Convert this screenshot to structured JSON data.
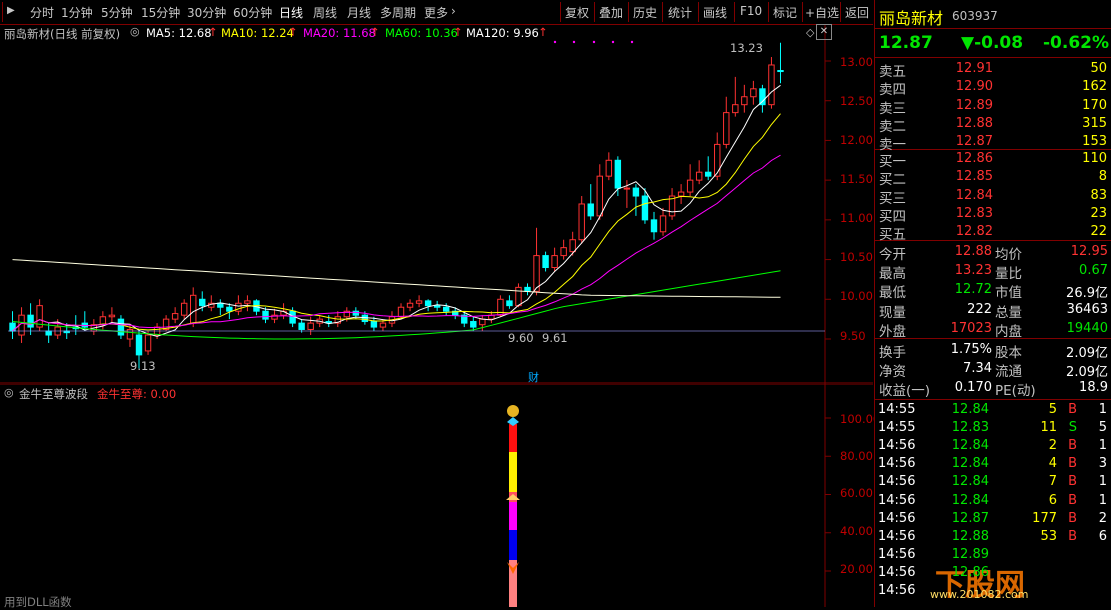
{
  "toolbar": {
    "periods": [
      "分时",
      "1分钟",
      "5分钟",
      "15分钟",
      "30分钟",
      "60分钟",
      "日线",
      "周线",
      "月线",
      "多周期",
      "更多"
    ],
    "active_period": "日线",
    "more_arrow": "›",
    "actions": [
      "复权",
      "叠加",
      "历史",
      "统计",
      "画线",
      "F10",
      "标记",
      "+自选",
      "返回"
    ]
  },
  "main_chart": {
    "header": "丽岛新材(日线 前复权)",
    "ma": [
      {
        "label": "MA5: 12.68",
        "color": "#ffffff"
      },
      {
        "label": "MA10: 12.24",
        "color": "#ffff00"
      },
      {
        "label": "MA20: 11.68",
        "color": "#ff00ff"
      },
      {
        "label": "MA60: 10.36",
        "color": "#00ff00"
      },
      {
        "label": "MA120: 9.96",
        "color": "#ffffff"
      }
    ],
    "up_arrow": "↑",
    "price_ticks": [
      "13.00",
      "12.50",
      "12.00",
      "11.50",
      "11.00",
      "10.50",
      "10.00",
      "9.50"
    ],
    "annotations": {
      "high": "13.23",
      "low": "9.13",
      "mid1": "9.60",
      "mid2": "9.61",
      "cai": "财"
    }
  },
  "sub_chart": {
    "indicator_name": "金牛至尊波段",
    "value_label": "金牛至尊: 0.00",
    "ticks": [
      "100.00",
      "80.00",
      "60.00",
      "40.00",
      "20.00"
    ],
    "dll_text": "用到DLL函数"
  },
  "quote": {
    "name": "丽岛新材",
    "code": "603937",
    "price": "12.87",
    "change": "▼-0.08",
    "pct": "-0.62%",
    "sell": [
      {
        "label": "卖五",
        "price": "12.91",
        "vol": "50"
      },
      {
        "label": "卖四",
        "price": "12.90",
        "vol": "162"
      },
      {
        "label": "卖三",
        "price": "12.89",
        "vol": "170"
      },
      {
        "label": "卖二",
        "price": "12.88",
        "vol": "315"
      },
      {
        "label": "卖一",
        "price": "12.87",
        "vol": "153"
      }
    ],
    "buy": [
      {
        "label": "买一",
        "price": "12.86",
        "vol": "110"
      },
      {
        "label": "买二",
        "price": "12.85",
        "vol": "8"
      },
      {
        "label": "买三",
        "price": "12.84",
        "vol": "83"
      },
      {
        "label": "买四",
        "price": "12.83",
        "vol": "23"
      },
      {
        "label": "买五",
        "price": "12.82",
        "vol": "22"
      }
    ],
    "stats": [
      {
        "l1": "今开",
        "v1": "12.88",
        "c1": "red",
        "l2": "均价",
        "v2": "12.95",
        "c2": "red"
      },
      {
        "l1": "最高",
        "v1": "13.23",
        "c1": "red",
        "l2": "量比",
        "v2": "0.67",
        "c2": "green"
      },
      {
        "l1": "最低",
        "v1": "12.72",
        "c1": "green",
        "l2": "市值",
        "v2": "26.9亿",
        "c2": "white"
      },
      {
        "l1": "现量",
        "v1": "222",
        "c1": "white",
        "l2": "总量",
        "v2": "36463",
        "c2": "white"
      },
      {
        "l1": "外盘",
        "v1": "17023",
        "c1": "red",
        "l2": "内盘",
        "v2": "19440",
        "c2": "green"
      }
    ],
    "fin": [
      {
        "l1": "换手",
        "v1": "1.75%",
        "l2": "股本",
        "v2": "2.09亿"
      },
      {
        "l1": "净资",
        "v1": "7.34",
        "l2": "流通",
        "v2": "2.09亿"
      },
      {
        "l1": "收益(一)",
        "v1": "0.170",
        "l2": "PE(动)",
        "v2": "18.9"
      }
    ],
    "ticks": [
      {
        "t": "14:55",
        "p": "12.84",
        "v": "5",
        "bs": "B",
        "n": "1"
      },
      {
        "t": "14:55",
        "p": "12.83",
        "v": "11",
        "bs": "S",
        "n": "5"
      },
      {
        "t": "14:56",
        "p": "12.84",
        "v": "2",
        "bs": "B",
        "n": "1"
      },
      {
        "t": "14:56",
        "p": "12.84",
        "v": "4",
        "bs": "B",
        "n": "3"
      },
      {
        "t": "14:56",
        "p": "12.84",
        "v": "7",
        "bs": "B",
        "n": "1"
      },
      {
        "t": "14:56",
        "p": "12.84",
        "v": "6",
        "bs": "B",
        "n": "1"
      },
      {
        "t": "14:56",
        "p": "12.87",
        "v": "177",
        "bs": "B",
        "n": "2"
      },
      {
        "t": "14:56",
        "p": "12.88",
        "v": "53",
        "bs": "B",
        "n": "6"
      },
      {
        "t": "14:56",
        "p": "12.89",
        "v": "",
        "bs": "",
        "n": ""
      },
      {
        "t": "14:56",
        "p": "12.86",
        "v": "",
        "bs": "",
        "n": ""
      },
      {
        "t": "14:56",
        "p": "",
        "v": "",
        "bs": "",
        "n": ""
      }
    ],
    "watermark": "下股网",
    "watermark_url": "www.201082.com"
  },
  "colors": {
    "up": "#ff3232",
    "down": "#00ffff",
    "grid": "#800000",
    "ma5": "#ffffff",
    "ma10": "#ffff00",
    "ma20": "#ff00ff",
    "ma60": "#00ff00",
    "ma120": "#ffffe0"
  },
  "chart_data": {
    "type": "candlestick",
    "y_range": [
      9.2,
      13.3
    ],
    "candles": [
      [
        9.7,
        9.6,
        9.85,
        9.5
      ],
      [
        9.55,
        9.8,
        9.9,
        9.45
      ],
      [
        9.8,
        9.65,
        9.95,
        9.55
      ],
      [
        9.65,
        9.92,
        10.0,
        9.6
      ],
      [
        9.6,
        9.55,
        9.7,
        9.45
      ],
      [
        9.55,
        9.65,
        9.75,
        9.5
      ],
      [
        9.6,
        9.58,
        9.7,
        9.5
      ],
      [
        9.65,
        9.63,
        9.8,
        9.55
      ],
      [
        9.7,
        9.65,
        9.85,
        9.6
      ],
      [
        9.6,
        9.68,
        9.75,
        9.55
      ],
      [
        9.68,
        9.78,
        9.85,
        9.62
      ],
      [
        9.78,
        9.8,
        9.9,
        9.7
      ],
      [
        9.75,
        9.55,
        9.8,
        9.5
      ],
      [
        9.5,
        9.62,
        9.68,
        9.4
      ],
      [
        9.55,
        9.3,
        9.6,
        9.13
      ],
      [
        9.35,
        9.55,
        9.6,
        9.3
      ],
      [
        9.55,
        9.65,
        9.7,
        9.5
      ],
      [
        9.62,
        9.75,
        9.8,
        9.6
      ],
      [
        9.75,
        9.82,
        9.9,
        9.7
      ],
      [
        9.8,
        9.95,
        10.0,
        9.75
      ],
      [
        9.7,
        10.05,
        10.15,
        9.65
      ],
      [
        10.0,
        9.92,
        10.1,
        9.85
      ],
      [
        9.9,
        9.95,
        10.05,
        9.85
      ],
      [
        9.95,
        9.9,
        10.0,
        9.8
      ],
      [
        9.9,
        9.85,
        9.95,
        9.75
      ],
      [
        9.85,
        9.95,
        10.05,
        9.8
      ],
      [
        9.95,
        9.98,
        10.05,
        9.85
      ],
      [
        9.98,
        9.85,
        10.0,
        9.8
      ],
      [
        9.85,
        9.75,
        9.9,
        9.7
      ],
      [
        9.75,
        9.8,
        9.88,
        9.7
      ],
      [
        9.8,
        9.85,
        9.95,
        9.75
      ],
      [
        9.85,
        9.7,
        9.9,
        9.65
      ],
      [
        9.7,
        9.62,
        9.75,
        9.58
      ],
      [
        9.62,
        9.7,
        9.78,
        9.55
      ],
      [
        9.7,
        9.75,
        9.8,
        9.65
      ],
      [
        9.72,
        9.7,
        9.8,
        9.65
      ],
      [
        9.7,
        9.78,
        9.85,
        9.65
      ],
      [
        9.78,
        9.85,
        9.9,
        9.72
      ],
      [
        9.85,
        9.8,
        9.9,
        9.75
      ],
      [
        9.8,
        9.72,
        9.85,
        9.68
      ],
      [
        9.72,
        9.65,
        9.78,
        9.6
      ],
      [
        9.65,
        9.7,
        9.75,
        9.6
      ],
      [
        9.7,
        9.78,
        9.85,
        9.65
      ],
      [
        9.78,
        9.9,
        9.95,
        9.75
      ],
      [
        9.9,
        9.95,
        10.0,
        9.85
      ],
      [
        9.95,
        9.98,
        10.05,
        9.9
      ],
      [
        9.98,
        9.92,
        10.0,
        9.85
      ],
      [
        9.92,
        9.9,
        9.98,
        9.85
      ],
      [
        9.9,
        9.85,
        9.95,
        9.8
      ],
      [
        9.85,
        9.8,
        9.9,
        9.75
      ],
      [
        9.8,
        9.7,
        9.85,
        9.65
      ],
      [
        9.72,
        9.65,
        9.78,
        9.6
      ],
      [
        9.68,
        9.75,
        9.8,
        9.6
      ],
      [
        9.75,
        9.8,
        9.85,
        9.7
      ],
      [
        9.8,
        10.0,
        10.05,
        9.78
      ],
      [
        9.98,
        9.92,
        10.05,
        9.88
      ],
      [
        9.92,
        10.15,
        10.2,
        9.9
      ],
      [
        10.15,
        10.1,
        10.2,
        10.05
      ],
      [
        10.1,
        10.55,
        10.9,
        10.05
      ],
      [
        10.55,
        10.4,
        10.6,
        10.35
      ],
      [
        10.4,
        10.55,
        10.65,
        10.35
      ],
      [
        10.55,
        10.65,
        10.75,
        10.5
      ],
      [
        10.6,
        10.75,
        10.85,
        10.55
      ],
      [
        10.75,
        11.2,
        11.3,
        10.7
      ],
      [
        11.2,
        11.05,
        11.45,
        11.0
      ],
      [
        11.05,
        11.55,
        11.7,
        11.0
      ],
      [
        11.55,
        11.75,
        11.85,
        11.5
      ],
      [
        11.75,
        11.4,
        11.8,
        11.3
      ],
      [
        11.4,
        11.4,
        11.5,
        11.15
      ],
      [
        11.4,
        11.3,
        11.45,
        11.05
      ],
      [
        11.3,
        11.0,
        11.4,
        10.95
      ],
      [
        11.0,
        10.85,
        11.1,
        10.75
      ],
      [
        10.85,
        11.05,
        11.15,
        10.8
      ],
      [
        11.05,
        11.3,
        11.4,
        11.0
      ],
      [
        11.3,
        11.35,
        11.45,
        11.2
      ],
      [
        11.35,
        11.5,
        11.7,
        11.3
      ],
      [
        11.5,
        11.6,
        11.75,
        11.45
      ],
      [
        11.6,
        11.55,
        11.8,
        11.5
      ],
      [
        11.55,
        11.95,
        12.1,
        11.5
      ],
      [
        11.95,
        12.35,
        12.55,
        11.9
      ],
      [
        12.35,
        12.45,
        12.8,
        12.3
      ],
      [
        12.45,
        12.55,
        12.7,
        12.35
      ],
      [
        12.55,
        12.65,
        12.75,
        12.45
      ],
      [
        12.65,
        12.45,
        12.7,
        12.35
      ],
      [
        12.45,
        12.95,
        13.05,
        12.4
      ],
      [
        12.88,
        12.87,
        13.23,
        12.72
      ]
    ],
    "ma_series": [
      "MA5",
      "MA10",
      "MA20",
      "MA60",
      "MA120"
    ],
    "sub_indicator": {
      "name": "金牛至尊",
      "value": 0.0,
      "y_range": [
        0,
        110
      ]
    }
  }
}
